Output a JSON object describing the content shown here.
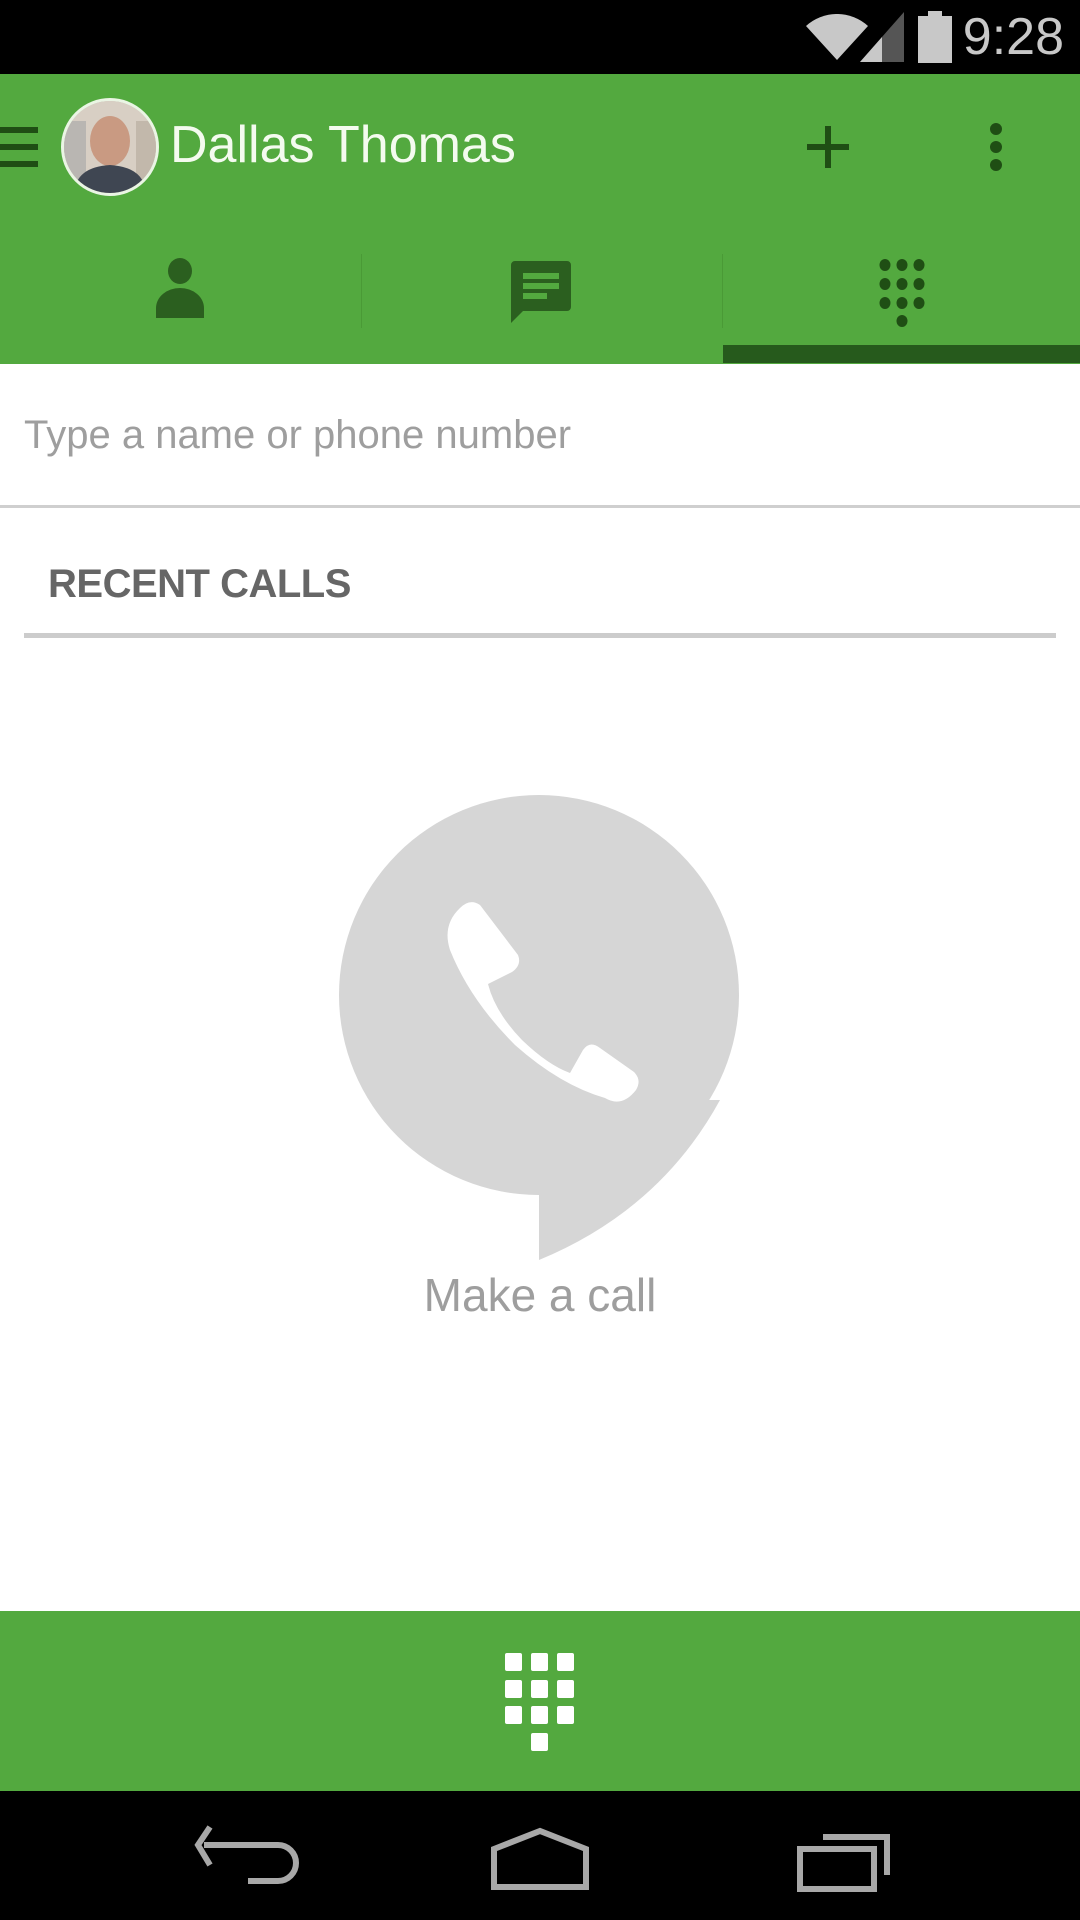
{
  "status_bar": {
    "time": "9:28",
    "icons": [
      "wifi-icon",
      "cell-signal-icon",
      "battery-icon"
    ]
  },
  "app_bar": {
    "menu_icon": "hamburger-menu-icon",
    "user_name": "Dallas Thomas",
    "avatar_alt": "Dallas Thomas profile photo",
    "actions": [
      {
        "name": "add",
        "icon": "plus-icon"
      },
      {
        "name": "more",
        "icon": "overflow-menu-icon"
      }
    ]
  },
  "tabs": [
    {
      "name": "contacts",
      "icon": "person-icon",
      "selected": false
    },
    {
      "name": "messages",
      "icon": "chat-bubble-icon",
      "selected": false
    },
    {
      "name": "dialer",
      "icon": "dialpad-icon",
      "selected": true
    }
  ],
  "search": {
    "placeholder": "Type a name or phone number",
    "value": ""
  },
  "recent_calls": {
    "title": "RECENT CALLS",
    "empty_state": {
      "icon": "phone-bubble-icon",
      "text": "Make a call"
    }
  },
  "bottom_bar": {
    "dialpad_icon": "dialpad-icon"
  },
  "nav_bar": {
    "buttons": [
      "back",
      "home",
      "recents"
    ]
  },
  "colors": {
    "primary": "#53a93f",
    "primary_dark": "#265a1c",
    "icon_dark": "#1f4e14",
    "illustration_gray": "#d6d6d6",
    "secondary_text": "#9e9e9e"
  }
}
